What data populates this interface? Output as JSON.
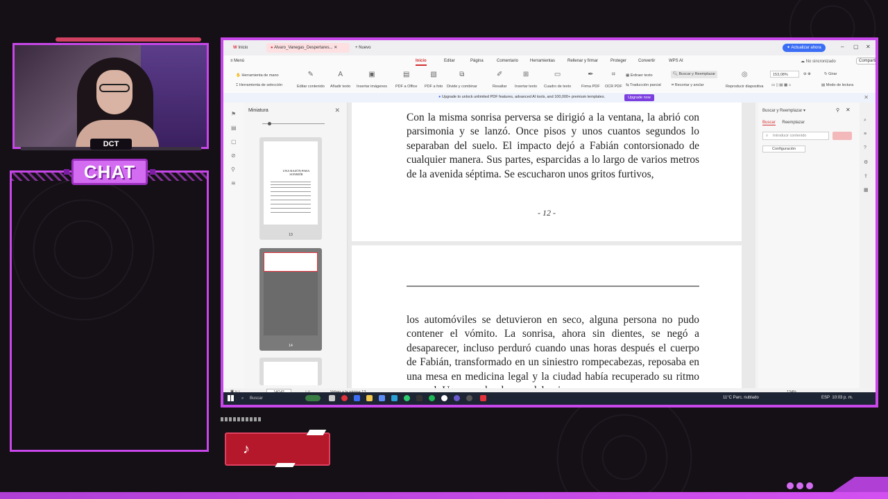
{
  "overlay": {
    "cam_label": "DCT",
    "chat_title": "CHAT",
    "tiktok_icon": "tiktok-icon"
  },
  "window": {
    "tabs": [
      {
        "label": "Inicio"
      },
      {
        "label": "Alvaro_Vanegas_Despertares..."
      },
      {
        "label": "Nuevo"
      }
    ],
    "update_button": "Actualizar ahora",
    "menu_label": "Menú",
    "menu": [
      "Inicio",
      "Editar",
      "Página",
      "Comentario",
      "Herramientas",
      "Rellenar y firmar",
      "Proteger",
      "Convertir",
      "WPS AI"
    ],
    "sync_status": "No sincronizado",
    "share_button": "Compartir",
    "toolbar": {
      "hand": "Herramienta de mano",
      "select": "Herramienta de selección",
      "edit_content": "Editar contenido",
      "add_text": "Añadir texto",
      "insert_images": "Insertar imágenes",
      "pdf_office": "PDF a Office",
      "pdf_photo": "PDF a foto",
      "split_merge": "Divide y combinar",
      "highlight": "Resaltar",
      "insert_text": "Insertar texto",
      "text_box": "Cuadro de texto",
      "sign_pdf": "Firma PDF",
      "ocr": "OCR PDF",
      "erase_text": "Erdraer texto",
      "find_replace": "Buscar y Reemplazar",
      "partial_translate": "Traducción parcial",
      "crop": "Recortar y anclar",
      "slideshow": "Reproducir diapositiva",
      "zoom": "153,08%",
      "rotate": "Girar",
      "reading_mode": "Modo de lectura"
    },
    "banner": {
      "text": "Upgrade to unlock unlimited PDF features, advanced AI tools, and 100,000+ premium templates.",
      "button": "Upgrade now"
    },
    "thumbnails": {
      "title": "Miniatura",
      "page13_title": "UNA RAZÓN PARA SONREÍR",
      "pages": [
        "13",
        "14"
      ]
    },
    "document": {
      "page1_text": "Con la misma sonrisa perversa se dirigió a la ventana, la abrió con parsimonia y se lanzó. Once pisos y unos cuantos segundos lo separaban del suelo. El impacto dejó a Fabián contorsionado de cualquier manera. Sus partes, esparcidas a lo largo de varios metros de la avenida séptima. Se escucharon unos gritos furtivos,",
      "page_number": "- 12 -",
      "page2_text": "los automóviles se detuvieron en seco, alguna persona no pudo contener el vómito. La sonrisa, ahora sin dientes, se negó a desaparecer, incluso perduró cuando unas horas después el cuerpo de Fabián, transformado en un siniestro rompecabezas, reposaba en una mesa en medicina legal y la ciudad había recuperado su ritmo normal. Una macabra broma del universo."
    },
    "find_panel": {
      "title": "Buscar y Reemplazar",
      "tab_find": "Buscar",
      "tab_replace": "Reemplazar",
      "placeholder": "Introducir contenido",
      "settings": "Configuración"
    },
    "status": {
      "page_indicator": "14/143",
      "back_link": "Volver a la página 13",
      "zoom": "134%"
    }
  },
  "taskbar": {
    "search": "Buscar",
    "weather": "11°C  Parc. nublado",
    "lang": "ESP",
    "time": "10:03 p. m."
  },
  "colors": {
    "accent_overlay": "#c847ea",
    "wps_red": "#d32f2f",
    "update_blue": "#3b6ef5",
    "tiktok_red": "#b5182b"
  }
}
